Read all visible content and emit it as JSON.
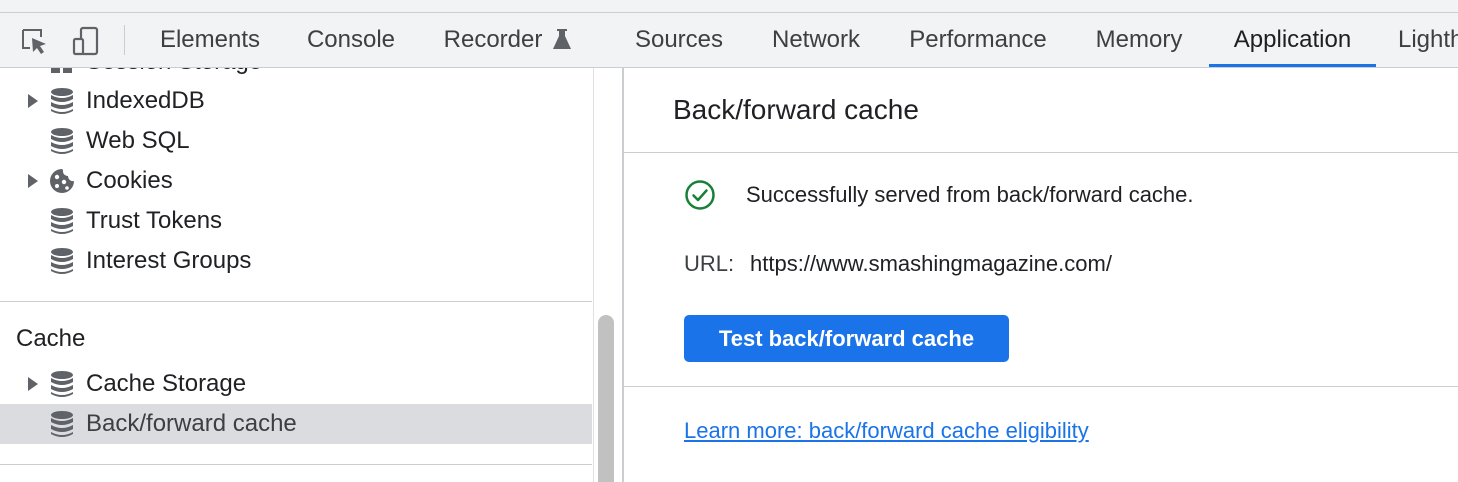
{
  "toolbar": {
    "inspect_icon": "select-element-icon",
    "device_icon": "device-toolbar-icon",
    "tabs": [
      {
        "label": "Elements"
      },
      {
        "label": "Console"
      },
      {
        "label": "Recorder"
      },
      {
        "label": "Sources"
      },
      {
        "label": "Network"
      },
      {
        "label": "Performance"
      },
      {
        "label": "Memory"
      },
      {
        "label": "Application"
      },
      {
        "label": "Lighth"
      }
    ],
    "active_tab": "Application",
    "accent_color": "#1a73e8"
  },
  "sidebar": {
    "cut_item": {
      "label": "Session Storage"
    },
    "storage_items": [
      {
        "label": "IndexedDB",
        "icon": "database-icon",
        "expandable": true
      },
      {
        "label": "Web SQL",
        "icon": "database-icon",
        "expandable": false
      },
      {
        "label": "Cookies",
        "icon": "cookie-icon",
        "expandable": true
      },
      {
        "label": "Trust Tokens",
        "icon": "database-icon",
        "expandable": false
      },
      {
        "label": "Interest Groups",
        "icon": "database-icon",
        "expandable": false
      }
    ],
    "cache_section": {
      "title": "Cache",
      "items": [
        {
          "label": "Cache Storage",
          "icon": "database-icon",
          "expandable": true
        },
        {
          "label": "Back/forward cache",
          "icon": "database-icon",
          "expandable": false,
          "selected": true
        }
      ]
    }
  },
  "main": {
    "title": "Back/forward cache",
    "status": {
      "icon": "check-circle-icon",
      "text": "Successfully served from back/forward cache.",
      "color": "#188038"
    },
    "url_label": "URL:",
    "url_value": "https://www.smashingmagazine.com/",
    "test_button_label": "Test back/forward cache",
    "learn_more_link": "Learn more: back/forward cache eligibility"
  }
}
